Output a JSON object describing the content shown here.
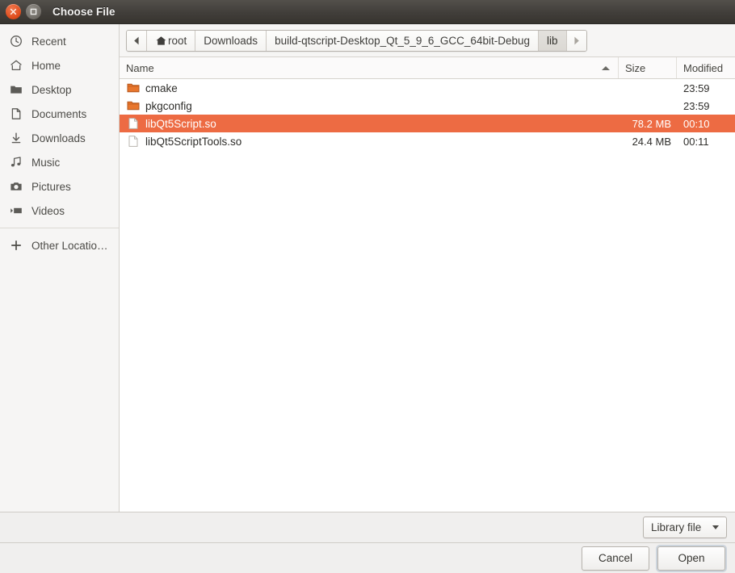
{
  "window": {
    "title": "Choose File",
    "close_icon": "close-icon",
    "maximize_icon": "maximize-icon",
    "accent_color": "#ed6b43",
    "titlebar_color": "#413e3a"
  },
  "sidebar": {
    "items": [
      {
        "label": "Recent",
        "icon": "clock-icon"
      },
      {
        "label": "Home",
        "icon": "home-icon"
      },
      {
        "label": "Desktop",
        "icon": "folder-icon"
      },
      {
        "label": "Documents",
        "icon": "document-icon"
      },
      {
        "label": "Downloads",
        "icon": "download-icon"
      },
      {
        "label": "Music",
        "icon": "music-note-icon"
      },
      {
        "label": "Pictures",
        "icon": "camera-icon"
      },
      {
        "label": "Videos",
        "icon": "film-icon"
      }
    ],
    "other_locations": {
      "label": "Other Locatio…",
      "icon": "plus-icon"
    }
  },
  "pathbar": {
    "back_icon": "left-arrow-icon",
    "forward_icon": "right-arrow-icon",
    "crumbs": [
      {
        "label": "root",
        "icon": "home-icon",
        "active": false
      },
      {
        "label": "Downloads",
        "active": false
      },
      {
        "label": "build-qtscript-Desktop_Qt_5_9_6_GCC_64bit-Debug",
        "active": false
      },
      {
        "label": "lib",
        "active": true
      }
    ]
  },
  "filelist": {
    "columns": {
      "name": "Name",
      "size": "Size",
      "modified": "Modified"
    },
    "sort_icon": "sort-ascending-icon",
    "rows": [
      {
        "name": "cmake",
        "size": "",
        "modified": "23:59",
        "icon": "folder-icon",
        "selected": false
      },
      {
        "name": "pkgconfig",
        "size": "",
        "modified": "23:59",
        "icon": "folder-icon",
        "selected": false
      },
      {
        "name": "libQt5Script.so",
        "size": "78.2 MB",
        "modified": "00:10",
        "icon": "file-icon",
        "selected": true
      },
      {
        "name": "libQt5ScriptTools.so",
        "size": "24.4 MB",
        "modified": "00:11",
        "icon": "file-icon",
        "selected": false
      }
    ]
  },
  "filterbar": {
    "filter": {
      "label": "Library file",
      "caret_icon": "chevron-down-icon"
    }
  },
  "actionbar": {
    "cancel_label": "Cancel",
    "open_label": "Open"
  }
}
